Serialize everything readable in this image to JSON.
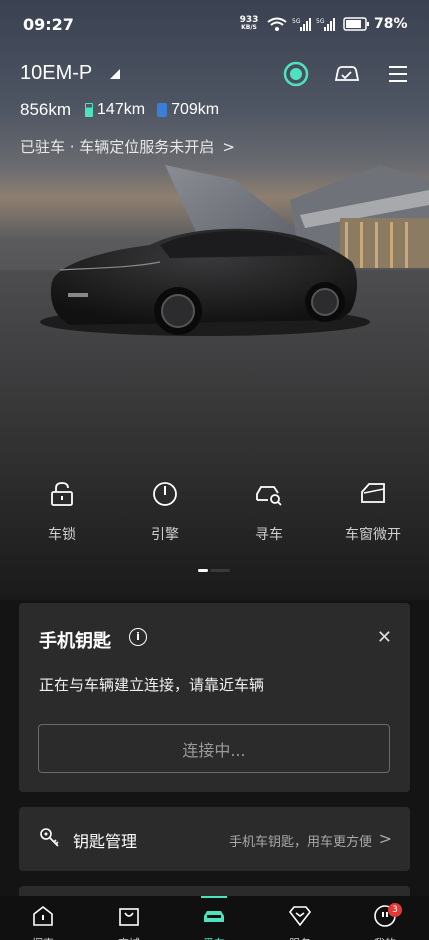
{
  "status_bar": {
    "time": "09:27",
    "net_speed": "933",
    "net_unit": "KB/S",
    "signal_1": "5G",
    "signal_2": "5G",
    "battery": "78%"
  },
  "header": {
    "model": "10EM-P",
    "icons": [
      "status-ring-icon",
      "car-check-icon",
      "menu-icon"
    ]
  },
  "range": {
    "total": "856km",
    "electric": "147km",
    "fuel": "709km"
  },
  "status": {
    "text": "已驻车 · 车辆定位服务未开启",
    "chevron": ">"
  },
  "actions": [
    {
      "label": "车锁",
      "icon": "lock-icon"
    },
    {
      "label": "引擎",
      "icon": "power-icon"
    },
    {
      "label": "寻车",
      "icon": "find-car-icon"
    },
    {
      "label": "车窗微开",
      "icon": "window-icon"
    }
  ],
  "pager": {
    "active": 0,
    "count": 2
  },
  "phone_key": {
    "title": "手机钥匙",
    "close": "✕",
    "message": "正在与车辆建立连接，请靠近车辆",
    "button": "连接中..."
  },
  "key_manager": {
    "title": "钥匙管理",
    "desc": "手机车钥匙，用车更方便",
    "chevron": ">"
  },
  "bottom_nav": [
    {
      "label": "探索",
      "icon": "explore-icon"
    },
    {
      "label": "商城",
      "icon": "shop-icon"
    },
    {
      "label": "爱车",
      "icon": "car-icon"
    },
    {
      "label": "服务",
      "icon": "service-icon"
    },
    {
      "label": "我的",
      "icon": "profile-icon",
      "badge": "3"
    }
  ],
  "colors": {
    "accent": "#4ee3bf",
    "card": "#2b2b2b",
    "background": "#141414",
    "badge": "#e53935"
  }
}
